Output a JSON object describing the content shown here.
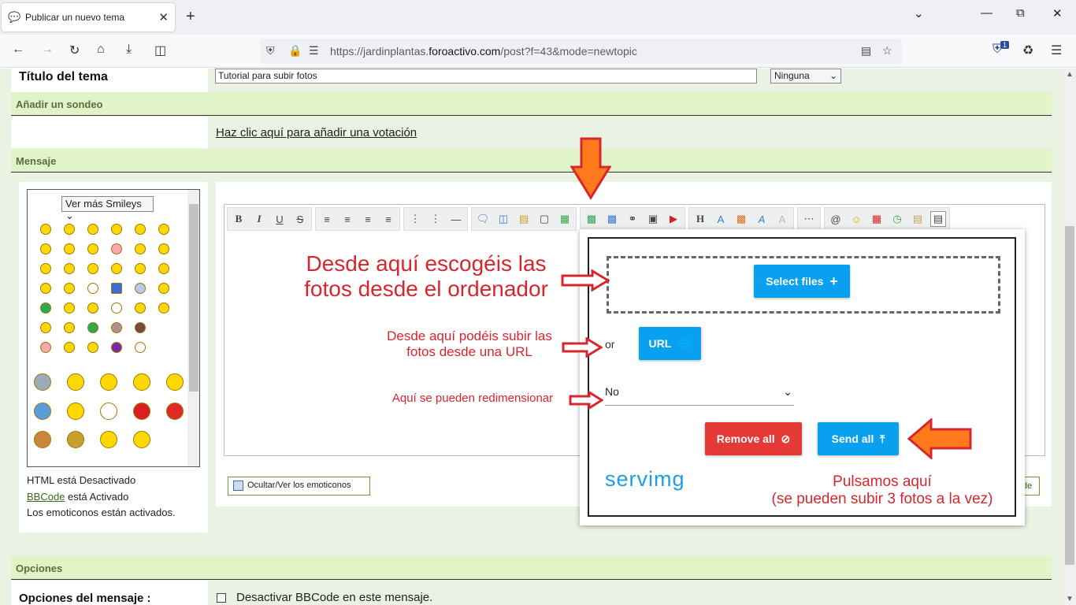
{
  "browser": {
    "tab_title": "Publicar un nuevo tema",
    "url_prefix": "https://jardinplantas.",
    "url_domain": "foroactivo.com",
    "url_path": "/post?f=43&mode=newtopic",
    "ext_badge": "1"
  },
  "form": {
    "title_label": "Título del tema",
    "title_value": "Tutorial para subir fotos",
    "icon_select": "Ninguna",
    "poll_header": "Añadir un sondeo",
    "poll_link": "Haz clic aquí para añadir una votación",
    "message_header": "Mensaje",
    "options_header": "Opciones",
    "options_label": "Opciones del mensaje :",
    "disable_bbcode": "Desactivar BBCode en este mensaje."
  },
  "smileys": {
    "select_label": "Ver más Smileys",
    "html_status": "HTML está Desactivado",
    "bbcode_link": "BBCode",
    "bbcode_status": " está Activado",
    "emoticons_status": "Los emoticonos están activados.",
    "toggle_button": "Ocultar/Ver los emoticonos",
    "right_button": "de"
  },
  "uploader": {
    "select_files": "Select files",
    "or": "or",
    "url_button": "URL",
    "resize_value": "No",
    "remove_all": "Remove all",
    "send_all": "Send all",
    "brand": "servimg"
  },
  "annotations": {
    "note1": "Desde aquí escogéis las fotos desde el ordenador",
    "note2": "Desde aquí podéis subir las fotos desde una URL",
    "note3": "Aquí se pueden redimensionar",
    "note4_line1": "Pulsamos aquí",
    "note4_line2": "(se pueden subir 3 fotos a la vez)"
  },
  "colors": {
    "accent_red": "#d8262e",
    "arrow_orange": "#ff7a1a",
    "button_blue": "#0aa0f0",
    "button_red": "#e53935",
    "header_green": "#e0f4c8"
  }
}
